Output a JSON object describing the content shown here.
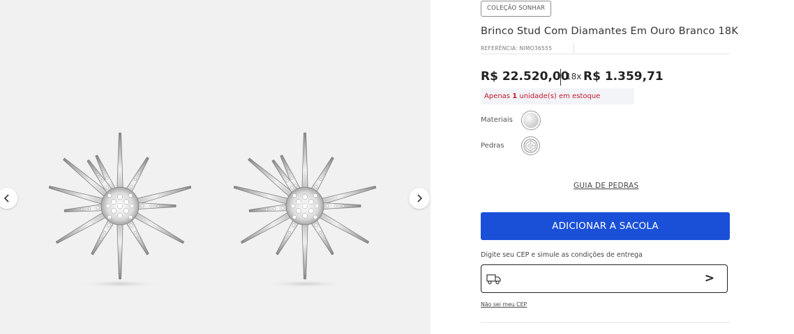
{
  "gallery": {
    "prev_icon": "chevron-left-icon",
    "next_icon": "chevron-right-icon"
  },
  "product": {
    "collection_badge": "COLEÇÃO SONHAR",
    "title": "Brinco Stud Com Diamantes Em Ouro Branco 18K",
    "reference": "REFERÊNCIA: NIMO36555",
    "price": "R$ 22.520,00",
    "installments": "18x",
    "installment_value": "R$ 1.359,71",
    "stock": {
      "prefix": "Apenas",
      "qty": "1",
      "suffix": "unidade(s) em estoque"
    },
    "materials_label": "Materiais",
    "stones_label": "Pedras",
    "stone_guide": "GUIA DE PEDRAS",
    "add_to_bag": "ADICIONAR A SACOLA",
    "accent_color": "#1a4fd8",
    "stock_color": "#c0182b"
  },
  "shipping": {
    "label": "Digite seu CEP e simule as condições de entrega",
    "input_value": "",
    "truck_icon": "truck-icon",
    "submit": ">",
    "unknown_cep": "Não sei meu CEP"
  }
}
